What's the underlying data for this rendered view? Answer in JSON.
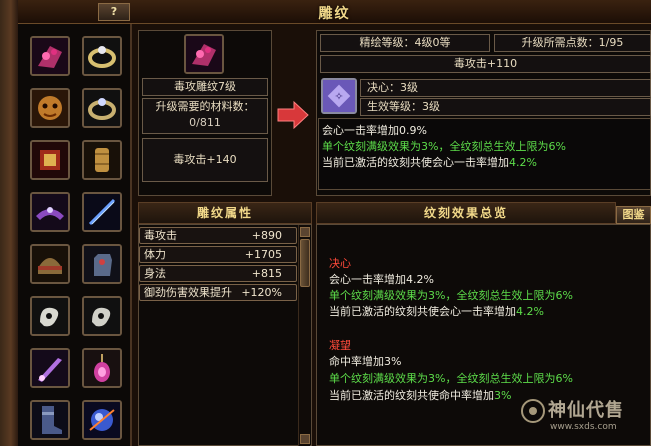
{
  "window": {
    "title": "雕纹",
    "help_label": "?"
  },
  "icon_grid": [
    "jewelry-icon",
    "ring-icon",
    "mask-icon",
    "ring-icon",
    "scroll-icon",
    "bracer-icon",
    "belt-icon",
    "blade-icon",
    "helmet-icon",
    "gauntlet-icon",
    "jade-icon",
    "jade-icon",
    "dagger-icon",
    "pendant-icon",
    "boots-icon",
    "orb-icon"
  ],
  "item": {
    "name": "毒攻雕纹7级",
    "req_label": "升级需要的材料数：",
    "req_value": "0/811",
    "stat": "毒攻击+140"
  },
  "result": {
    "level_label": "精绘等级：4级0等",
    "points_label": "升级所需点数：1/95",
    "stat": "毒攻击+110",
    "type_label": "决心：3级",
    "effect_level": "生效等级：3级",
    "desc1": "会心一击率增加0.9%",
    "desc2": "单个纹刻满级效果为3%，全纹刻总生效上限为6%",
    "desc3_a": "当前已激活的纹刻共使会心一击率增加",
    "desc3_b": "4.2%"
  },
  "attributes": {
    "header": "雕纹属性",
    "rows": [
      {
        "name": "毒攻击",
        "value": "+890"
      },
      {
        "name": "体力",
        "value": "+1705"
      },
      {
        "name": "身法",
        "value": "+815"
      },
      {
        "name": "御劲伤害效果提升",
        "value": "+120%"
      }
    ]
  },
  "overview": {
    "header": "纹刻效果总览",
    "button": "图鉴",
    "g1_title": "决心",
    "g1_l1": "会心一击率增加4.2%",
    "g1_l2": "单个纹刻满级效果为3%，全纹刻总生效上限为6%",
    "g1_l3a": "当前已激活的纹刻共使会心一击率增加",
    "g1_l3b": "4.2%",
    "g2_title": "凝望",
    "g2_l1": "命中率增加3%",
    "g2_l2": "单个纹刻满级效果为3%，全纹刻总生效上限为6%",
    "g2_l3a": "当前已激活的纹刻共使命中率增加",
    "g2_l3b": "3%"
  },
  "watermark": {
    "brand": "神仙代售",
    "url": "www.sxds.com"
  },
  "colors": {
    "accent": "#f2d98a",
    "green": "#5ddd4a",
    "red": "#ff4a3a"
  }
}
